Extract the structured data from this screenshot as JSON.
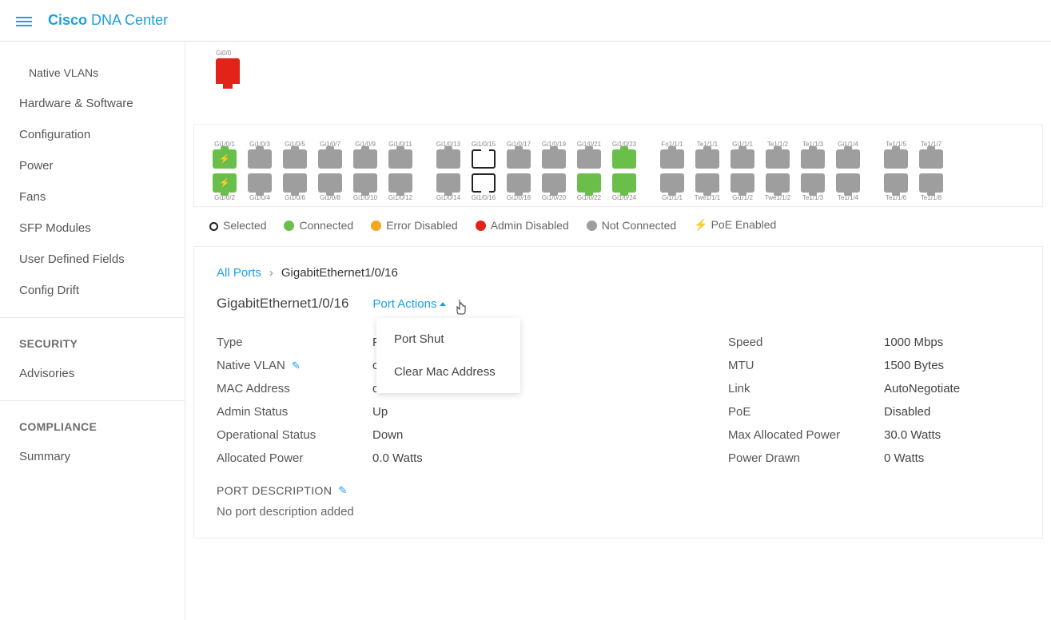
{
  "brand": {
    "bold": "Cisco",
    "light": "DNA Center"
  },
  "sidebar": {
    "sub": "Native VLANs",
    "items": [
      "Hardware & Software",
      "Configuration",
      "Power",
      "Fans",
      "SFP Modules",
      "User Defined Fields",
      "Config Drift"
    ],
    "sec_head": "SECURITY",
    "sec_items": [
      "Advisories"
    ],
    "comp_head": "COMPLIANCE",
    "comp_items": [
      "Summary"
    ]
  },
  "chassis": {
    "port0": "Gi0/0"
  },
  "port_blocks": [
    {
      "top": [
        {
          "lbl": "Gi1/0/1",
          "cls": "greenpoe poe"
        },
        {
          "lbl": "Gi1/0/3",
          "cls": ""
        },
        {
          "lbl": "Gi1/0/5",
          "cls": ""
        },
        {
          "lbl": "Gi1/0/7",
          "cls": ""
        },
        {
          "lbl": "Gi1/0/9",
          "cls": ""
        },
        {
          "lbl": "Gi1/0/11",
          "cls": ""
        }
      ],
      "bot": [
        {
          "lbl": "Gi1/0/2",
          "cls": "greenpoe poe"
        },
        {
          "lbl": "Gi1/0/4",
          "cls": ""
        },
        {
          "lbl": "Gi1/0/6",
          "cls": ""
        },
        {
          "lbl": "Gi1/0/8",
          "cls": ""
        },
        {
          "lbl": "Gi1/0/10",
          "cls": ""
        },
        {
          "lbl": "Gi1/0/12",
          "cls": ""
        }
      ]
    },
    {
      "top": [
        {
          "lbl": "Gi1/0/13",
          "cls": ""
        },
        {
          "lbl": "Gi1/0/15",
          "cls": "sel"
        },
        {
          "lbl": "Gi1/0/17",
          "cls": ""
        },
        {
          "lbl": "Gi1/0/19",
          "cls": ""
        },
        {
          "lbl": "Gi1/0/21",
          "cls": ""
        },
        {
          "lbl": "Gi1/0/23",
          "cls": "green"
        }
      ],
      "bot": [
        {
          "lbl": "Gi1/0/14",
          "cls": ""
        },
        {
          "lbl": "Gi1/0/16",
          "cls": "sel"
        },
        {
          "lbl": "Gi1/0/18",
          "cls": ""
        },
        {
          "lbl": "Gi1/0/20",
          "cls": ""
        },
        {
          "lbl": "Gi1/0/22",
          "cls": "green"
        },
        {
          "lbl": "Gi1/0/24",
          "cls": "green"
        }
      ]
    },
    {
      "top": [
        {
          "lbl": "Fo1/1/1",
          "cls": ""
        },
        {
          "lbl": "Te1/1/1",
          "cls": ""
        },
        {
          "lbl": "Gi1/1/1",
          "cls": ""
        },
        {
          "lbl": "Te1/1/2",
          "cls": ""
        },
        {
          "lbl": "Te1/1/3",
          "cls": ""
        },
        {
          "lbl": "Gi1/1/4",
          "cls": ""
        }
      ],
      "bot": [
        {
          "lbl": "Gi1/1/1",
          "cls": ""
        },
        {
          "lbl": "Twe1/1/1",
          "cls": ""
        },
        {
          "lbl": "Gi1/1/2",
          "cls": ""
        },
        {
          "lbl": "Twe1/1/2",
          "cls": ""
        },
        {
          "lbl": "Te1/1/3",
          "cls": ""
        },
        {
          "lbl": "Te1/1/4",
          "cls": ""
        }
      ]
    },
    {
      "top": [
        {
          "lbl": "Te1/1/5",
          "cls": ""
        },
        {
          "lbl": "Te1/1/7",
          "cls": ""
        }
      ],
      "bot": [
        {
          "lbl": "Te1/1/6",
          "cls": ""
        },
        {
          "lbl": "Te1/1/8",
          "cls": ""
        }
      ]
    }
  ],
  "legend": {
    "selected": "Selected",
    "connected": "Connected",
    "err": "Error Disabled",
    "admin": "Admin Disabled",
    "notconn": "Not Connected",
    "poe": "PoE Enabled"
  },
  "breadcrumb": {
    "all": "All Ports",
    "current": "GigabitEthernet1/0/16"
  },
  "port_title": "GigabitEthernet1/0/16",
  "port_actions": "Port Actions",
  "dropdown": {
    "shut": "Port Shut",
    "clear": "Clear Mac Address"
  },
  "left": {
    "type_k": "Type",
    "type_v": "P",
    "nvlan_k": "Native VLAN",
    "nvlan_v": "c",
    "mac_k": "MAC Address",
    "mac_v": "c",
    "admin_k": "Admin Status",
    "admin_v": "Up",
    "oper_k": "Operational Status",
    "oper_v": "Down",
    "alloc_k": "Allocated Power",
    "alloc_v": "0.0 Watts"
  },
  "right": {
    "speed_k": "Speed",
    "speed_v": "1000 Mbps",
    "mtu_k": "MTU",
    "mtu_v": "1500 Bytes",
    "link_k": "Link",
    "link_v": "AutoNegotiate",
    "poe_k": "PoE",
    "poe_v": "Disabled",
    "maxp_k": "Max Allocated Power",
    "maxp_v": "30.0 Watts",
    "drawn_k": "Power Drawn",
    "drawn_v": "0 Watts"
  },
  "pd_head": "PORT DESCRIPTION",
  "pd_val": "No port description added"
}
